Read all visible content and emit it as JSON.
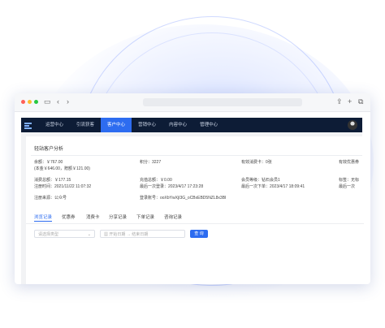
{
  "nav": {
    "items": [
      "运营中心",
      "引流获客",
      "客户中心",
      "营销中心",
      "内容中心",
      "管理中心"
    ],
    "active_index": 2
  },
  "section": {
    "title": "轻站客户分析"
  },
  "info": {
    "balance": "余额：￥767.00",
    "balance_detail": "(本金￥646.00，赠额￥121.00)",
    "points": "积分：3227",
    "valid_cards": "有效消费卡：0张",
    "valid_coupons": "有效优惠券",
    "total_spend": "消费总额：￥177.15",
    "recharge_total": "充值总额：￥0.00",
    "member_level": "会员等级：钻石会员1",
    "tag": "标签：无标",
    "register_time": "注册时间：2021/11/22 11:07:32",
    "last_login": "最后一次登录：2023/4/17 17:23:28",
    "last_order": "最后一次下单：2023/4/17 18:09:41",
    "last_time": "最后一次",
    "source": "注册来源：公众号",
    "login_account": "登录账号：ooXbYwXjI3G_oCBxEBD5NZL8x3BI"
  },
  "tabs": [
    "浏览记录",
    "优惠券",
    "消费卡",
    "分享记录",
    "下单记录",
    "咨询记录"
  ],
  "filters": {
    "type_placeholder": "请选择类型",
    "start_date": "开始日期",
    "end_date": "结束日期",
    "search_label": "查 询"
  },
  "colors": {
    "nav_bg": "#0d1c36",
    "accent": "#2d6cf0",
    "warning": "#e0463c"
  }
}
